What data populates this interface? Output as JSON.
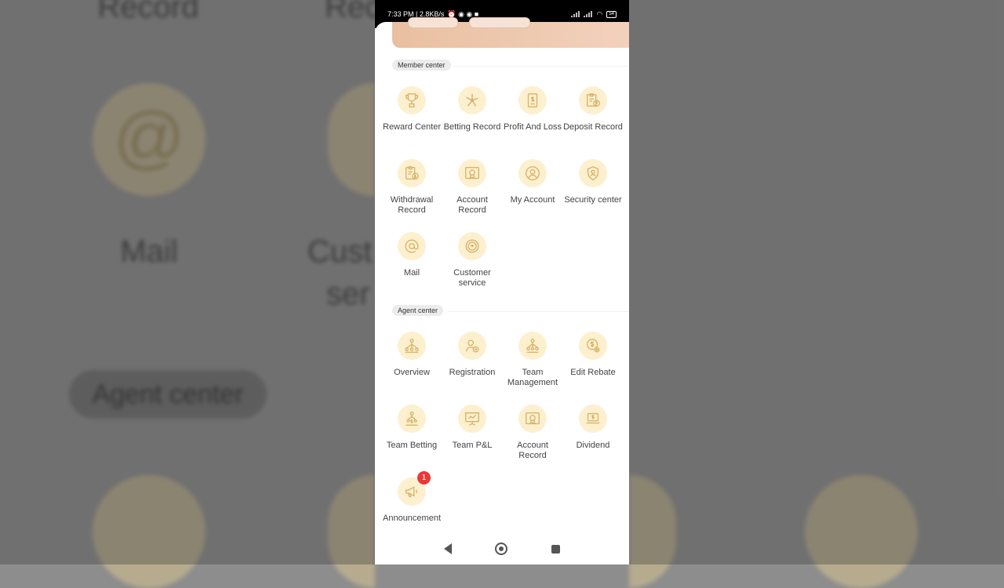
{
  "status_bar": {
    "time_speed": "7:33 PM | 2.8KB/s",
    "battery": "54"
  },
  "member_center": {
    "title": "Member center",
    "items": [
      {
        "label": "Reward Center",
        "icon": "trophy-icon"
      },
      {
        "label": "Betting Record",
        "icon": "pinwheel-icon"
      },
      {
        "label": "Profit And Loss",
        "icon": "ledger-dollar-icon"
      },
      {
        "label": "Deposit Record",
        "icon": "clipboard-upload-icon"
      },
      {
        "label": "Withdrawal Record",
        "icon": "clipboard-download-icon"
      },
      {
        "label": "Account Record",
        "icon": "certificate-icon"
      },
      {
        "label": "My Account",
        "icon": "user-circle-icon"
      },
      {
        "label": "Security center",
        "icon": "shield-user-icon"
      },
      {
        "label": "Mail",
        "icon": "at-sign-icon"
      },
      {
        "label": "Customer service",
        "icon": "support-24-7-icon"
      }
    ]
  },
  "agent_center": {
    "title": "Agent center",
    "items": [
      {
        "label": "Overview",
        "icon": "hierarchy-icon"
      },
      {
        "label": "Registration",
        "icon": "add-user-icon"
      },
      {
        "label": "Team Management",
        "icon": "team-hierarchy-icon"
      },
      {
        "label": "Edit Rebate",
        "icon": "dollar-gear-icon"
      },
      {
        "label": "Team Betting",
        "icon": "team-money-icon"
      },
      {
        "label": "Team P&L",
        "icon": "presentation-chart-icon"
      },
      {
        "label": "Account Record",
        "icon": "certificate-icon"
      },
      {
        "label": "Dividend",
        "icon": "laptop-dollar-icon"
      },
      {
        "label": "Announcement",
        "icon": "megaphone-icon",
        "badge": "1"
      }
    ]
  },
  "background": {
    "record_left": "Record",
    "record_right": "Reco",
    "mail": "Mail",
    "customer_line1": "Cust",
    "customer_line2": "ser",
    "agent_center": "Agent center"
  },
  "colors": {
    "accent": "#d7b46a",
    "icon_bg": "#fdf0cf",
    "badge": "#e8383a"
  }
}
